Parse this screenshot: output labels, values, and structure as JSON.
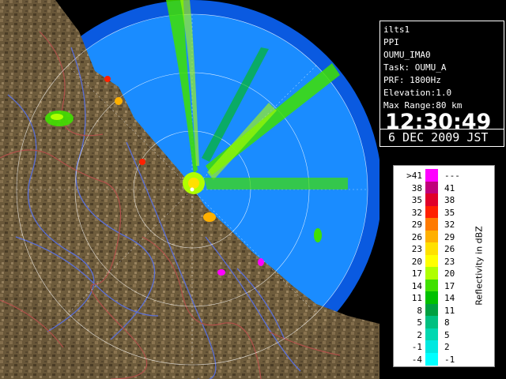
{
  "info": {
    "station": "ilts1",
    "mode": "PPI",
    "product": "OUMU_IMA0",
    "task": "Task: OUMU_A",
    "prf": "PRF: 1800Hz",
    "elevation": "Elevation:1.0",
    "max_range": "Max Range:80 km",
    "time": "12:30:49",
    "date": "6 DEC 2009 JST"
  },
  "legend": {
    "unit_label": "Reflectivity in dBZ",
    "rows": [
      {
        "lo": ">41",
        "hi": "---",
        "color": "#ff00ff"
      },
      {
        "lo": "38",
        "hi": "41",
        "color": "#c0007a"
      },
      {
        "lo": "35",
        "hi": "38",
        "color": "#e0002a"
      },
      {
        "lo": "32",
        "hi": "35",
        "color": "#ff2000"
      },
      {
        "lo": "29",
        "hi": "32",
        "color": "#ff7a00"
      },
      {
        "lo": "26",
        "hi": "29",
        "color": "#ffb000"
      },
      {
        "lo": "23",
        "hi": "26",
        "color": "#ffe000"
      },
      {
        "lo": "20",
        "hi": "23",
        "color": "#ffff00"
      },
      {
        "lo": "17",
        "hi": "20",
        "color": "#b0ff00"
      },
      {
        "lo": "14",
        "hi": "17",
        "color": "#40e000"
      },
      {
        "lo": "11",
        "hi": "14",
        "color": "#00c000"
      },
      {
        "lo": "8",
        "hi": "11",
        "color": "#00a040"
      },
      {
        "lo": "5",
        "hi": "8",
        "color": "#00c080"
      },
      {
        "lo": "2",
        "hi": "5",
        "color": "#00d8b0"
      },
      {
        "lo": "-1",
        "hi": "2",
        "color": "#00e8e0"
      },
      {
        "lo": "-4",
        "hi": "-1",
        "color": "#00ffff"
      }
    ]
  },
  "colors": {
    "radar_sweep": "#1a8cff",
    "radar_outer": "#0a66e0",
    "land": "#6b5a3a",
    "river": "#5a6fd6",
    "boundary": "#b0504a"
  },
  "icons": [
    "radar-site-icon"
  ]
}
